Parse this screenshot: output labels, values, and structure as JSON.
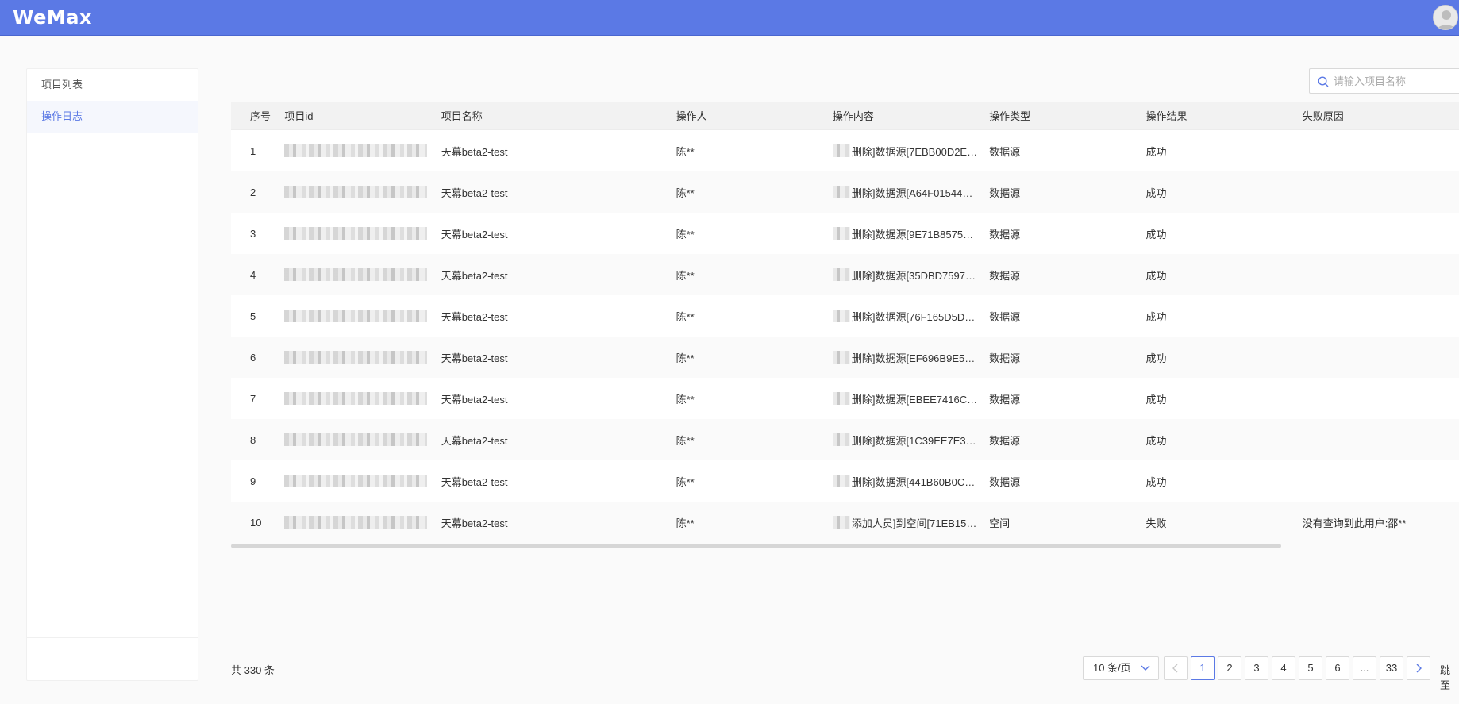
{
  "app": {
    "logo": "WeMax"
  },
  "sidebar": {
    "items": [
      {
        "label": "项目列表",
        "active": false
      },
      {
        "label": "操作日志",
        "active": true
      }
    ]
  },
  "search": {
    "placeholder": "请输入项目名称",
    "value": ""
  },
  "table": {
    "columns": [
      "序号",
      "项目id",
      "项目名称",
      "操作人",
      "操作内容",
      "操作类型",
      "操作结果",
      "失败原因"
    ],
    "rows": [
      {
        "idx": "1",
        "name": "天幕beta2-test",
        "operator": "陈**",
        "content": "删除]数据源[7EBB00D2EC...",
        "type": "数据源",
        "result": "成功",
        "reason": ""
      },
      {
        "idx": "2",
        "name": "天幕beta2-test",
        "operator": "陈**",
        "content": "删除]数据源[A64F01544E6...",
        "type": "数据源",
        "result": "成功",
        "reason": ""
      },
      {
        "idx": "3",
        "name": "天幕beta2-test",
        "operator": "陈**",
        "content": "删除]数据源[9E71B857562...",
        "type": "数据源",
        "result": "成功",
        "reason": ""
      },
      {
        "idx": "4",
        "name": "天幕beta2-test",
        "operator": "陈**",
        "content": "删除]数据源[35DBD759778...",
        "type": "数据源",
        "result": "成功",
        "reason": ""
      },
      {
        "idx": "5",
        "name": "天幕beta2-test",
        "operator": "陈**",
        "content": "删除]数据源[76F165D5D2D...",
        "type": "数据源",
        "result": "成功",
        "reason": ""
      },
      {
        "idx": "6",
        "name": "天幕beta2-test",
        "operator": "陈**",
        "content": "删除]数据源[EF696B9E5C...",
        "type": "数据源",
        "result": "成功",
        "reason": ""
      },
      {
        "idx": "7",
        "name": "天幕beta2-test",
        "operator": "陈**",
        "content": "删除]数据源[EBEE7416C61...",
        "type": "数据源",
        "result": "成功",
        "reason": ""
      },
      {
        "idx": "8",
        "name": "天幕beta2-test",
        "operator": "陈**",
        "content": "删除]数据源[1C39EE7E3C...",
        "type": "数据源",
        "result": "成功",
        "reason": ""
      },
      {
        "idx": "9",
        "name": "天幕beta2-test",
        "operator": "陈**",
        "content": "删除]数据源[441B60B0C3F...",
        "type": "数据源",
        "result": "成功",
        "reason": ""
      },
      {
        "idx": "10",
        "name": "天幕beta2-test",
        "operator": "陈**",
        "content": "添加人员]到空间[71EB1588...",
        "type": "空间",
        "result": "失败",
        "reason": "没有查询到此用户:邵**"
      }
    ]
  },
  "footer": {
    "total": "共 330 条",
    "page_size": "10 条/页",
    "pages": [
      "1",
      "2",
      "3",
      "4",
      "5",
      "6",
      "...",
      "33"
    ],
    "current_page": "1",
    "jump_label": "跳至"
  },
  "colors": {
    "header": "#5b79e5",
    "accent": "#5b79e5"
  }
}
